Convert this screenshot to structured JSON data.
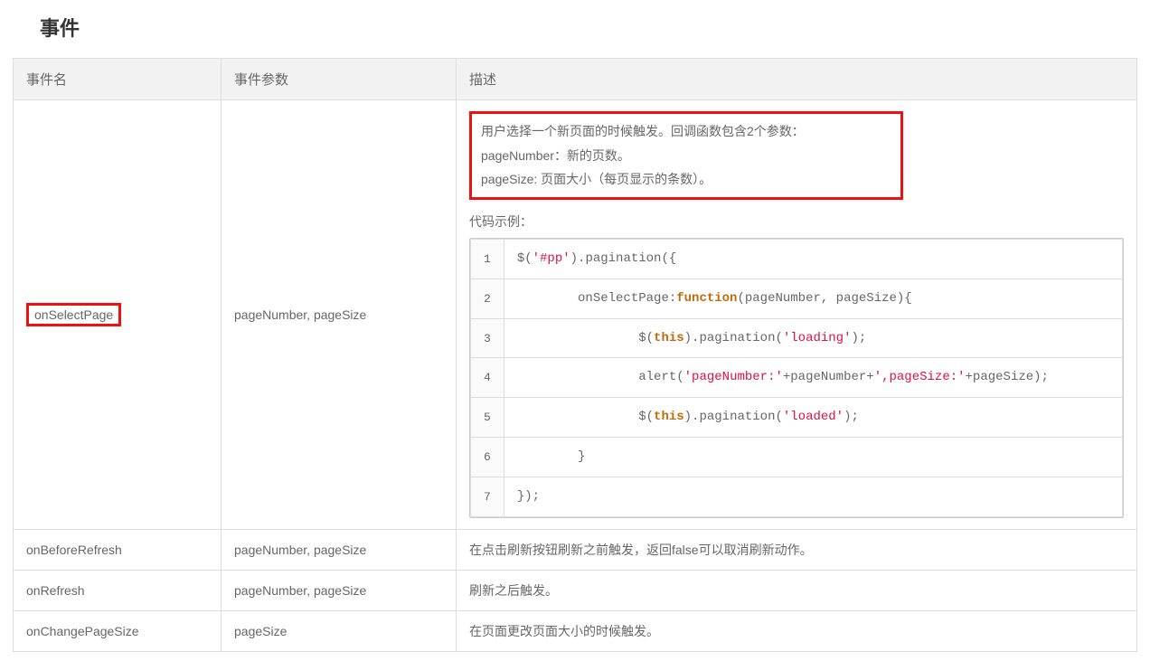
{
  "section_title": "事件",
  "headers": {
    "name": "事件名",
    "params": "事件参数",
    "desc": "描述"
  },
  "rows": [
    {
      "name": "onSelectPage",
      "params": "pageNumber, pageSize",
      "highlighted": true,
      "desc_lines": [
        "用户选择一个新页面的时候触发。回调函数包含2个参数：",
        "pageNumber：新的页数。",
        "pageSize: 页面大小（每页显示的条数）。"
      ],
      "code_label": "代码示例：",
      "code": [
        [
          {
            "t": "plain",
            "v": "$("
          },
          {
            "t": "str",
            "v": "'#pp'"
          },
          {
            "t": "plain",
            "v": ").pagination({"
          }
        ],
        [
          {
            "t": "plain",
            "v": "        onSelectPage:"
          },
          {
            "t": "kw",
            "v": "function"
          },
          {
            "t": "plain",
            "v": "(pageNumber, pageSize){"
          }
        ],
        [
          {
            "t": "plain",
            "v": "                $("
          },
          {
            "t": "this",
            "v": "this"
          },
          {
            "t": "plain",
            "v": ").pagination("
          },
          {
            "t": "str",
            "v": "'loading'"
          },
          {
            "t": "plain",
            "v": ");"
          }
        ],
        [
          {
            "t": "plain",
            "v": "                alert("
          },
          {
            "t": "str",
            "v": "'pageNumber:'"
          },
          {
            "t": "plain",
            "v": "+pageNumber+"
          },
          {
            "t": "str",
            "v": "',pageSize:'"
          },
          {
            "t": "plain",
            "v": "+pageSize);"
          }
        ],
        [
          {
            "t": "plain",
            "v": "                $("
          },
          {
            "t": "this",
            "v": "this"
          },
          {
            "t": "plain",
            "v": ").pagination("
          },
          {
            "t": "str",
            "v": "'loaded'"
          },
          {
            "t": "plain",
            "v": ");"
          }
        ],
        [
          {
            "t": "plain",
            "v": "        }"
          }
        ],
        [
          {
            "t": "plain",
            "v": "});"
          }
        ]
      ]
    },
    {
      "name": "onBeforeRefresh",
      "params": "pageNumber, pageSize",
      "desc_plain": "在点击刷新按钮刷新之前触发，返回false可以取消刷新动作。"
    },
    {
      "name": "onRefresh",
      "params": "pageNumber, pageSize",
      "desc_plain": "刷新之后触发。"
    },
    {
      "name": "onChangePageSize",
      "params": "pageSize",
      "desc_plain": "在页面更改页面大小的时候触发。"
    }
  ]
}
